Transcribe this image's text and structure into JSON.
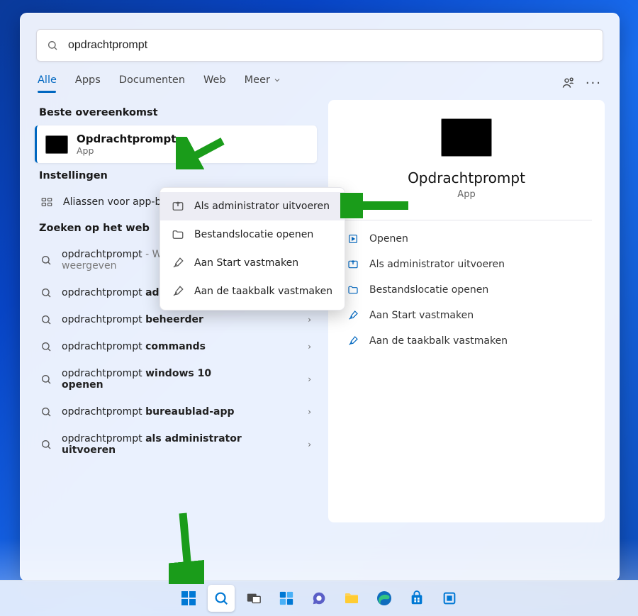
{
  "search": {
    "query": "opdrachtprompt"
  },
  "filters": {
    "all": "Alle",
    "apps": "Apps",
    "documents": "Documenten",
    "web": "Web",
    "more": "Meer"
  },
  "sections": {
    "best_match": "Beste overeenkomst",
    "settings": "Instellingen",
    "web": "Zoeken op het web"
  },
  "best_match_item": {
    "title": "Opdrachtprompt",
    "subtitle": "App"
  },
  "settings_items": [
    {
      "label": "Aliassen voor app-beheren"
    }
  ],
  "web_items": [
    {
      "prefix": "opdrachtprompt",
      "suffix": " - Webresultaten weergeven",
      "muted_suffix": true
    },
    {
      "prefix": "opdrachtprompt ",
      "bold": "administrator"
    },
    {
      "prefix": "opdrachtprompt ",
      "bold": "beheerder"
    },
    {
      "prefix": "opdrachtprompt ",
      "bold": "commands"
    },
    {
      "prefix": "opdrachtprompt ",
      "bold": "windows 10 openen"
    },
    {
      "prefix": "opdrachtprompt ",
      "bold": "bureaublad-app"
    },
    {
      "prefix": "opdrachtprompt ",
      "bold": "als administrator uitvoeren"
    }
  ],
  "context_menu": [
    "Als administrator uitvoeren",
    "Bestandslocatie openen",
    "Aan Start vastmaken",
    "Aan de taakbalk vastmaken"
  ],
  "detail": {
    "title": "Opdrachtprompt",
    "subtitle": "App",
    "actions": [
      "Openen",
      "Als administrator uitvoeren",
      "Bestandslocatie openen",
      "Aan Start vastmaken",
      "Aan de taakbalk vastmaken"
    ]
  }
}
